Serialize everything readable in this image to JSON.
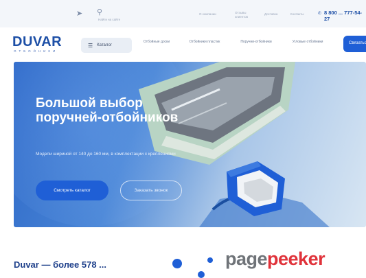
{
  "topbar": {
    "send_icon": "send-icon",
    "search_icon": "search-icon",
    "search_hint": "Найти на сайте",
    "links": [
      "О компании",
      "Отзывы клиентов",
      "Доставка",
      "Контакты"
    ],
    "phone": "8 800 ... 777-54-27",
    "phone_icon": "phone-icon"
  },
  "navbar": {
    "logo": "DUVAR",
    "logo_sub": "ОТБОЙНИКИ",
    "catalog_label": "Каталог",
    "menu_icon": "menu-icon",
    "items": [
      "Отбойные доски",
      "Отбойники пластик",
      "Поручни-отбойники",
      "Угловые отбойники"
    ],
    "cta_label": "Связаться"
  },
  "hero": {
    "title": "Большой выбор поручней-отбойников",
    "description": "Модели шириной от 140 до 160 мм, в комплектации с креплениями",
    "primary_button": "Смотреть каталог",
    "secondary_button": "Заказать звонок"
  },
  "section": {
    "title": "Duvar — более 578 ..."
  },
  "watermark": {
    "part1": "page",
    "part2": "peeker"
  },
  "colors": {
    "accent": "#1f5fd6",
    "brand": "#1d4fa6",
    "watermark_red": "#e0323a"
  }
}
